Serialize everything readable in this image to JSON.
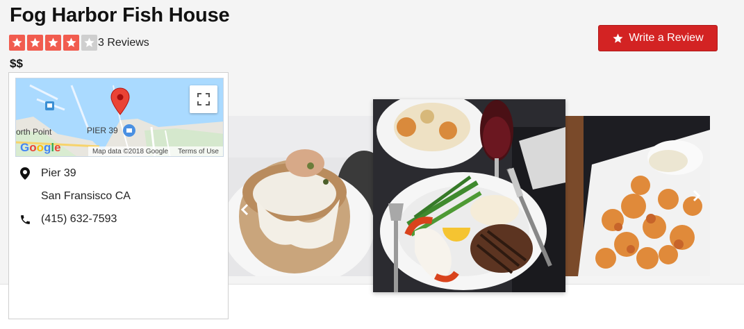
{
  "business": {
    "name": "Fog Harbor Fish House",
    "review_count": "3 Reviews",
    "rating": 4,
    "rating_max": 5,
    "price": "$$"
  },
  "actions": {
    "write_review_label": "Write a Review"
  },
  "map": {
    "labels": {
      "north_point": "orth Point",
      "pier39": "PIER 39"
    },
    "google": "Google",
    "map_data": "Map data ©2018 Google",
    "terms": "Terms of Use"
  },
  "location": {
    "address_line1": "Pier 39",
    "address_line2": "San Fransisco CA",
    "phone": "(415) 632-7593"
  },
  "colors": {
    "brand_red": "#d32323",
    "star_red": "#f15c4f",
    "star_empty": "#cfcfcf"
  },
  "icons": {
    "pin": "map-pin-icon",
    "phone": "phone-icon",
    "star": "star-icon",
    "expand": "fullscreen-icon",
    "prev": "chevron-left-icon",
    "next": "chevron-right-icon"
  }
}
